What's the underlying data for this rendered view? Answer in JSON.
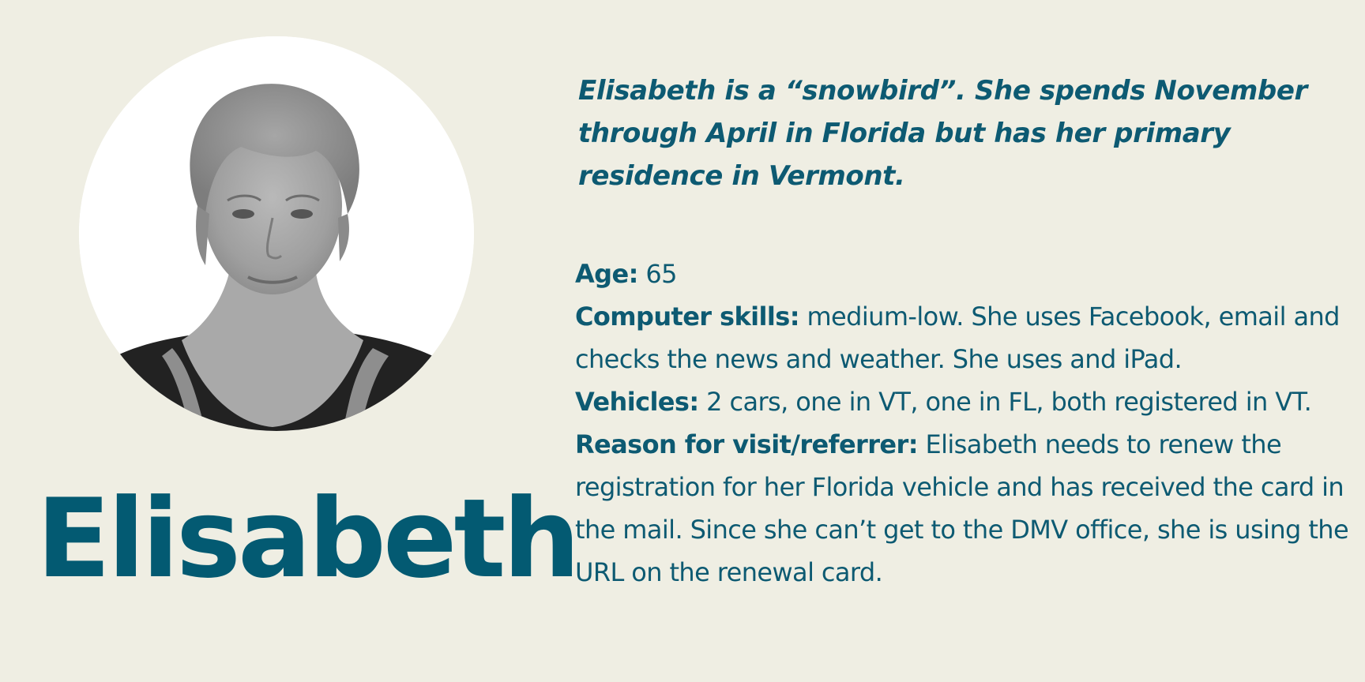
{
  "persona": {
    "name": "Elisabeth",
    "quote": "Elisabeth is a “snowbird”. She spends November through April in Florida but has her primary residence in Vermont.",
    "photo_icon": "portrait-photo",
    "details": [
      {
        "label": "Age:",
        "value": "65"
      },
      {
        "label": "Computer skills:",
        "value": "medium-low. She uses Facebook, email and checks the news and weather. She uses and iPad."
      },
      {
        "label": "Vehicles:",
        "value": "2 cars, one in VT, one in FL, both registered in VT."
      },
      {
        "label": "Reason for visit/referrer:",
        "value": "Elisabeth needs to renew the registration for her Florida vehicle and has received the card in the mail. Since she can’t get to the DMV office, she is using the URL on the renewal card."
      }
    ]
  },
  "colors": {
    "background": "#efeee3",
    "text": "#0d5a72",
    "portrait_bg": "#ffffff"
  }
}
